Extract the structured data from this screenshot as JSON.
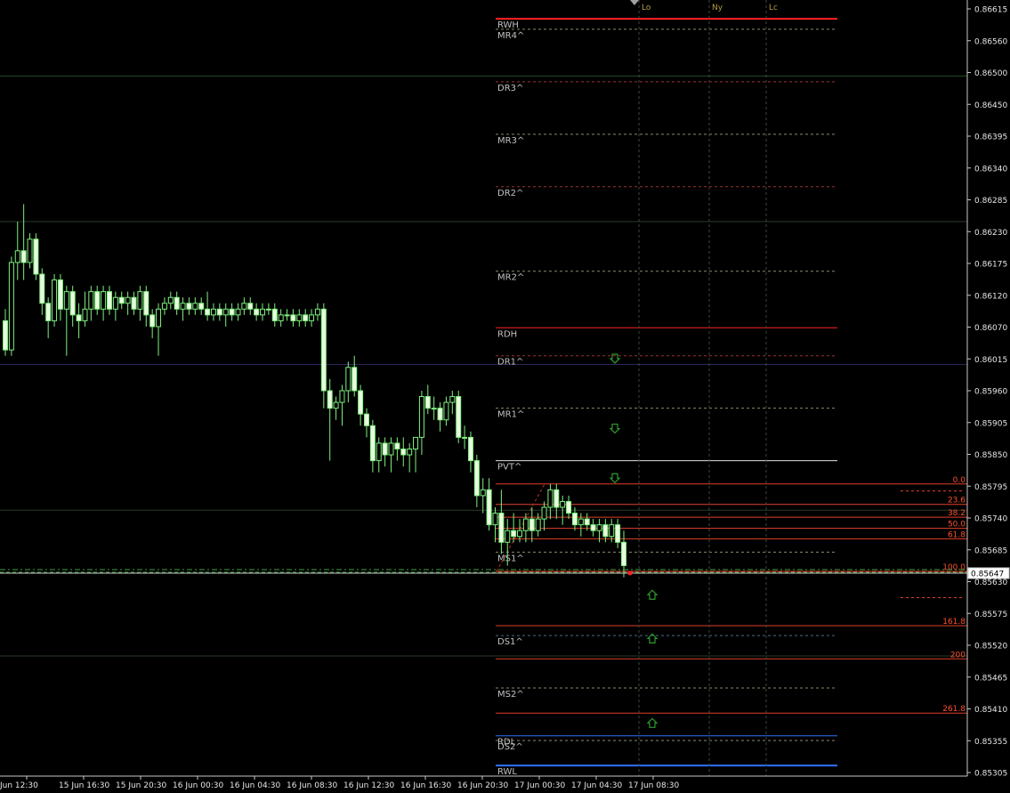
{
  "chart_data": {
    "type": "candlestick",
    "price_range": [
      0.8529,
      0.8668
    ],
    "y_ticks": [
      "0.86615",
      "0.86560",
      "0.86500",
      "0.86450",
      "0.86395",
      "0.86340",
      "0.86285",
      "0.86230",
      "0.86175",
      "0.86120",
      "0.86070",
      "0.86015",
      "0.85960",
      "0.85905",
      "0.85850",
      "0.85795",
      "0.85740",
      "0.85685",
      "0.85630",
      "0.85575",
      "0.85520",
      "0.85465",
      "0.85410",
      "0.85355",
      "0.85305"
    ],
    "x_ticks": [
      "Jun 12:30",
      "15 Jun 16:30",
      "15 Jun 20:30",
      "16 Jun 00:30",
      "16 Jun 04:30",
      "16 Jun 08:30",
      "16 Jun 12:30",
      "16 Jun 16:30",
      "16 Jun 20:30",
      "17 Jun 00:30",
      "17 Jun 04:30",
      "17 Jun 08:30"
    ],
    "current_price": "0.85647",
    "pivot_levels": [
      {
        "label": "RWH",
        "value": 0.86598,
        "color": "#ff2020",
        "style": "solid"
      },
      {
        "label": "MR4^",
        "value": 0.8658,
        "color": "#8a8a6a",
        "style": "dashed"
      },
      {
        "label": "DR3^",
        "value": 0.8649,
        "color": "#a03030",
        "style": "dashed"
      },
      {
        "label": "MR3^",
        "value": 0.864,
        "color": "#8a8a6a",
        "style": "dashed"
      },
      {
        "label": "DR2^",
        "value": 0.8631,
        "color": "#a03030",
        "style": "dashed"
      },
      {
        "label": "MR2^",
        "value": 0.86165,
        "color": "#8a8a6a",
        "style": "dashed"
      },
      {
        "label": "RDH",
        "value": 0.86068,
        "color": "#ff2020",
        "style": "solid"
      },
      {
        "label": "DR1^",
        "value": 0.8602,
        "color": "#a03030",
        "style": "dashed"
      },
      {
        "label": "MR1^",
        "value": 0.8593,
        "color": "#8a8a6a",
        "style": "dashed"
      },
      {
        "label": "PVT^",
        "value": 0.8584,
        "color": "#e0e0e0",
        "style": "solid"
      },
      {
        "label": "MS1^",
        "value": 0.85683,
        "color": "#8a8a6a",
        "style": "dashed"
      },
      {
        "label": "DS1^",
        "value": 0.8554,
        "color": "#4a6a8a",
        "style": "dashed"
      },
      {
        "label": "MS2^",
        "value": 0.8545,
        "color": "#8a8a6a",
        "style": "dashed"
      },
      {
        "label": "RDL",
        "value": 0.85368,
        "color": "#3070ff",
        "style": "solid"
      },
      {
        "label": "DS2^",
        "value": 0.8536,
        "color": "#8a8a6a",
        "style": "dashed"
      },
      {
        "label": "RWL",
        "value": 0.85317,
        "color": "#3070ff",
        "style": "solid"
      }
    ],
    "fib_levels": [
      {
        "label": "0.0",
        "value": 0.858
      },
      {
        "label": "23.6",
        "value": 0.85765
      },
      {
        "label": "38.2",
        "value": 0.85743
      },
      {
        "label": "50.0",
        "value": 0.85724
      },
      {
        "label": "61.8",
        "value": 0.85706
      },
      {
        "label": "100.0",
        "value": 0.8565
      },
      {
        "label": "161.8",
        "value": 0.85557
      },
      {
        "label": "200",
        "value": 0.855
      },
      {
        "label": "261.8",
        "value": 0.85407
      }
    ],
    "sessions": [
      "Lo",
      "Ny",
      "Lc"
    ],
    "horizontal_lines": [
      {
        "value": 0.865,
        "color": "#2a4a2a"
      },
      {
        "value": 0.8625,
        "color": "#2a3a2a"
      },
      {
        "value": 0.86005,
        "color": "#2a2a5a"
      },
      {
        "value": 0.85755,
        "color": "#2a3a2a"
      },
      {
        "value": 0.85505,
        "color": "#2a3a2a"
      }
    ],
    "arrows": [
      {
        "dir": "down",
        "value": 0.86015
      },
      {
        "dir": "down",
        "value": 0.85895
      },
      {
        "dir": "down",
        "value": 0.8581
      },
      {
        "dir": "up",
        "value": 0.8561
      },
      {
        "dir": "up",
        "value": 0.85535
      },
      {
        "dir": "up",
        "value": 0.8539
      }
    ],
    "candles": [
      [
        0.8608,
        0.861,
        0.8602,
        0.8603
      ],
      [
        0.8603,
        0.8619,
        0.8602,
        0.8618
      ],
      [
        0.8618,
        0.8625,
        0.8615,
        0.862
      ],
      [
        0.862,
        0.8628,
        0.8615,
        0.8618
      ],
      [
        0.8618,
        0.8623,
        0.8617,
        0.8622
      ],
      [
        0.8622,
        0.8623,
        0.8615,
        0.8616
      ],
      [
        0.8616,
        0.8617,
        0.8609,
        0.8611
      ],
      [
        0.8611,
        0.8612,
        0.8605,
        0.8608
      ],
      [
        0.8608,
        0.8616,
        0.8607,
        0.8615
      ],
      [
        0.8615,
        0.8616,
        0.8608,
        0.861
      ],
      [
        0.861,
        0.8614,
        0.8602,
        0.8613
      ],
      [
        0.8613,
        0.8614,
        0.8607,
        0.8609
      ],
      [
        0.8609,
        0.8611,
        0.8605,
        0.8608
      ],
      [
        0.8608,
        0.8613,
        0.8607,
        0.861
      ],
      [
        0.861,
        0.8614,
        0.8608,
        0.8613
      ],
      [
        0.8613,
        0.8614,
        0.8609,
        0.861
      ],
      [
        0.861,
        0.8614,
        0.8608,
        0.8613
      ],
      [
        0.8613,
        0.8614,
        0.8609,
        0.861
      ],
      [
        0.861,
        0.8613,
        0.8608,
        0.8612
      ],
      [
        0.8612,
        0.8613,
        0.861,
        0.8611
      ],
      [
        0.8611,
        0.8613,
        0.8609,
        0.8612
      ],
      [
        0.8612,
        0.8613,
        0.8609,
        0.861
      ],
      [
        0.861,
        0.8614,
        0.8608,
        0.8613
      ],
      [
        0.8613,
        0.8614,
        0.8607,
        0.8609
      ],
      [
        0.8609,
        0.861,
        0.8605,
        0.8607
      ],
      [
        0.8607,
        0.8611,
        0.8602,
        0.861
      ],
      [
        0.861,
        0.8612,
        0.8609,
        0.8611
      ],
      [
        0.8611,
        0.8613,
        0.861,
        0.8612
      ],
      [
        0.8612,
        0.8613,
        0.8609,
        0.861
      ],
      [
        0.861,
        0.8612,
        0.8608,
        0.8611
      ],
      [
        0.8611,
        0.8612,
        0.8609,
        0.861
      ],
      [
        0.861,
        0.8612,
        0.8609,
        0.8611
      ],
      [
        0.8611,
        0.8612,
        0.8609,
        0.861
      ],
      [
        0.861,
        0.8613,
        0.8608,
        0.8609
      ],
      [
        0.8609,
        0.8611,
        0.8608,
        0.861
      ],
      [
        0.861,
        0.8611,
        0.8608,
        0.8609
      ],
      [
        0.8609,
        0.8611,
        0.8607,
        0.861
      ],
      [
        0.861,
        0.8611,
        0.8608,
        0.8609
      ],
      [
        0.8609,
        0.8611,
        0.8608,
        0.861
      ],
      [
        0.861,
        0.8612,
        0.8609,
        0.8611
      ],
      [
        0.8611,
        0.8612,
        0.8609,
        0.861
      ],
      [
        0.861,
        0.8611,
        0.8608,
        0.8609
      ],
      [
        0.8609,
        0.8611,
        0.8608,
        0.861
      ],
      [
        0.861,
        0.8611,
        0.8609,
        0.861
      ],
      [
        0.861,
        0.8611,
        0.8607,
        0.8608
      ],
      [
        0.8608,
        0.861,
        0.8607,
        0.8609
      ],
      [
        0.8609,
        0.861,
        0.8608,
        0.8609
      ],
      [
        0.8609,
        0.861,
        0.8607,
        0.8608
      ],
      [
        0.8608,
        0.861,
        0.8607,
        0.8609
      ],
      [
        0.8609,
        0.861,
        0.8607,
        0.8608
      ],
      [
        0.8608,
        0.861,
        0.8607,
        0.8609
      ],
      [
        0.8609,
        0.8611,
        0.8608,
        0.861
      ],
      [
        0.861,
        0.8611,
        0.8593,
        0.8596
      ],
      [
        0.8596,
        0.8598,
        0.8584,
        0.8593
      ],
      [
        0.8593,
        0.8595,
        0.8591,
        0.8594
      ],
      [
        0.8594,
        0.8597,
        0.859,
        0.8596
      ],
      [
        0.8596,
        0.8601,
        0.8594,
        0.86
      ],
      [
        0.86,
        0.8602,
        0.8595,
        0.8596
      ],
      [
        0.8596,
        0.8597,
        0.859,
        0.8592
      ],
      [
        0.8592,
        0.8593,
        0.8588,
        0.859
      ],
      [
        0.859,
        0.8591,
        0.8582,
        0.8584
      ],
      [
        0.8584,
        0.8588,
        0.8582,
        0.8587
      ],
      [
        0.8587,
        0.8588,
        0.8583,
        0.8585
      ],
      [
        0.8585,
        0.8588,
        0.8582,
        0.8587
      ],
      [
        0.8587,
        0.8588,
        0.8584,
        0.8586
      ],
      [
        0.8586,
        0.8588,
        0.8583,
        0.8585
      ],
      [
        0.8585,
        0.8587,
        0.8582,
        0.8586
      ],
      [
        0.8586,
        0.8588,
        0.8582,
        0.8588
      ],
      [
        0.8588,
        0.8596,
        0.8585,
        0.8595
      ],
      [
        0.8595,
        0.8597,
        0.8592,
        0.8593
      ],
      [
        0.8593,
        0.8595,
        0.8591,
        0.8593
      ],
      [
        0.8593,
        0.8594,
        0.8589,
        0.8591
      ],
      [
        0.8591,
        0.8595,
        0.859,
        0.8594
      ],
      [
        0.8594,
        0.8596,
        0.8592,
        0.8595
      ],
      [
        0.8595,
        0.8596,
        0.8587,
        0.8588
      ],
      [
        0.8588,
        0.859,
        0.8586,
        0.8588
      ],
      [
        0.8588,
        0.8589,
        0.8582,
        0.8584
      ],
      [
        0.8584,
        0.8585,
        0.8576,
        0.8578
      ],
      [
        0.8578,
        0.8581,
        0.8575,
        0.8579
      ],
      [
        0.8579,
        0.8581,
        0.8572,
        0.8573
      ],
      [
        0.8573,
        0.8576,
        0.857,
        0.8575
      ],
      [
        0.8575,
        0.8579,
        0.8568,
        0.857
      ],
      [
        0.857,
        0.8574,
        0.8566,
        0.8572
      ],
      [
        0.8572,
        0.8575,
        0.857,
        0.8571
      ],
      [
        0.8571,
        0.8574,
        0.857,
        0.8572
      ],
      [
        0.8572,
        0.8575,
        0.857,
        0.8574
      ],
      [
        0.8574,
        0.8576,
        0.857,
        0.8572
      ],
      [
        0.8572,
        0.8575,
        0.8571,
        0.8574
      ],
      [
        0.8574,
        0.8577,
        0.8572,
        0.8576
      ],
      [
        0.8576,
        0.858,
        0.8574,
        0.8579
      ],
      [
        0.8579,
        0.858,
        0.8574,
        0.8576
      ],
      [
        0.8576,
        0.8578,
        0.8573,
        0.8577
      ],
      [
        0.8577,
        0.8578,
        0.8574,
        0.8575
      ],
      [
        0.8575,
        0.8576,
        0.8572,
        0.8573
      ],
      [
        0.8573,
        0.8575,
        0.8571,
        0.8574
      ],
      [
        0.8574,
        0.8575,
        0.8572,
        0.8573
      ],
      [
        0.8573,
        0.8574,
        0.8571,
        0.8572
      ],
      [
        0.8572,
        0.8574,
        0.857,
        0.8573
      ],
      [
        0.8573,
        0.8574,
        0.857,
        0.8571
      ],
      [
        0.8571,
        0.8574,
        0.857,
        0.8573
      ],
      [
        0.8573,
        0.8574,
        0.8569,
        0.857
      ],
      [
        0.857,
        0.8572,
        0.8564,
        0.8566
      ]
    ]
  }
}
